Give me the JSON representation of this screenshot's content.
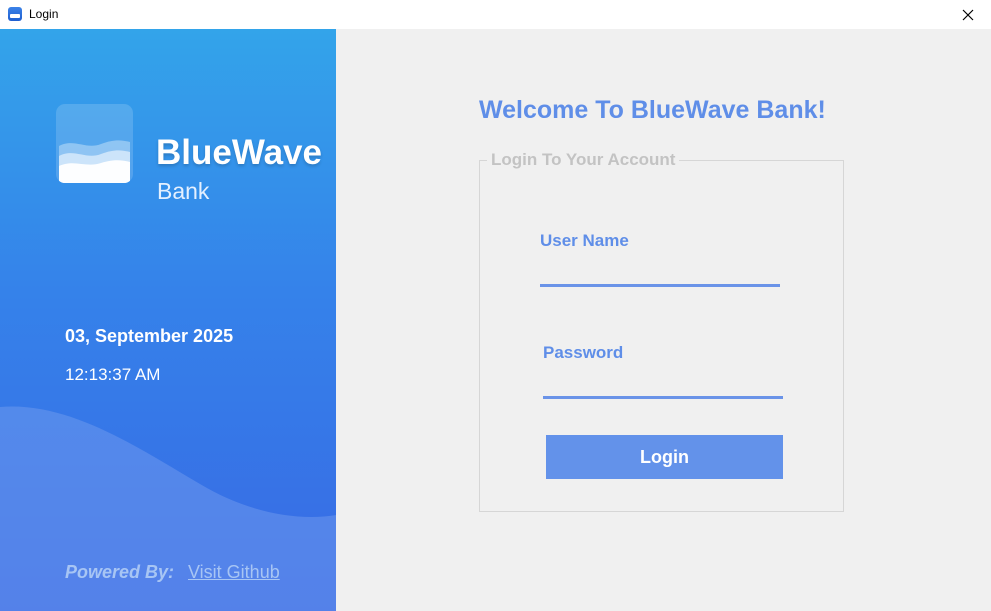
{
  "window": {
    "title": "Login"
  },
  "brand": {
    "name": "BlueWave",
    "subtitle": "Bank"
  },
  "clock": {
    "date": "03, September 2025",
    "time": "12:13:37 AM"
  },
  "footer": {
    "powered_by": "Powered By:",
    "link_text": "Visit Github"
  },
  "main": {
    "welcome": "Welcome To BlueWave Bank!",
    "group_title": "Login To Your Account",
    "username_label": "User Name",
    "username_value": "",
    "password_label": "Password",
    "password_value": "",
    "login_button": "Login"
  },
  "icons": {
    "app": "bank-wave-icon",
    "logo": "wave-logo-icon",
    "close": "close-icon"
  },
  "colors": {
    "accent": "#5f8ee8",
    "button": "#6392ea",
    "panel_top": "#33a4ea",
    "panel_bottom": "#3869e4",
    "background": "#f0f0f0"
  }
}
